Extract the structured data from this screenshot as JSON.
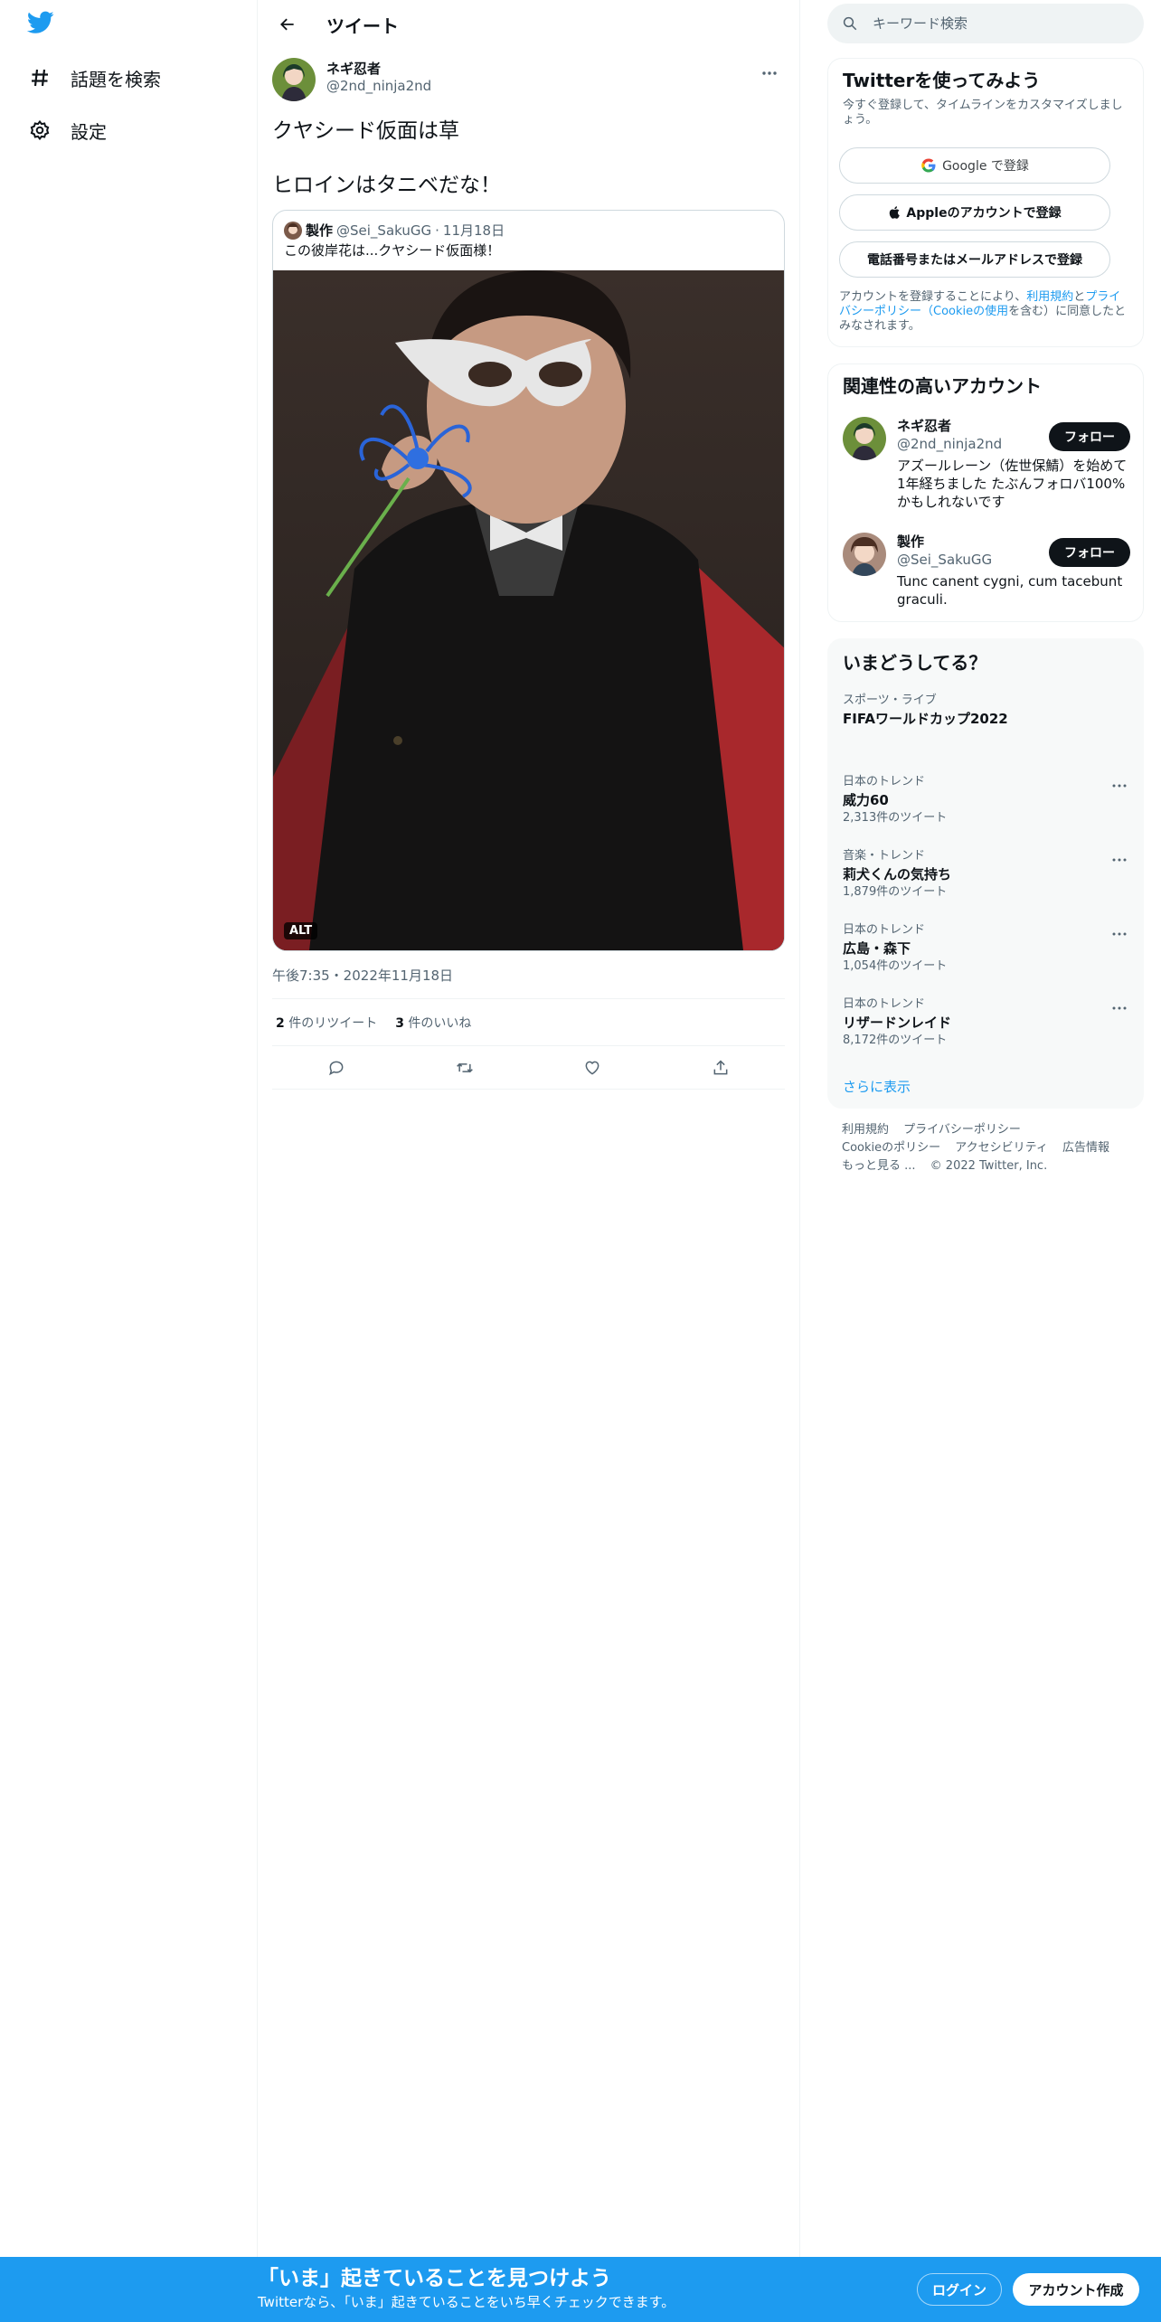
{
  "nav": {
    "items": [
      {
        "label": "話題を検索",
        "icon": "hashtag-icon"
      },
      {
        "label": "設定",
        "icon": "gear-icon"
      }
    ]
  },
  "header": {
    "title": "ツイート"
  },
  "tweet": {
    "author_name": "ネギ忍者",
    "author_handle": "@2nd_ninja2nd",
    "text_lines": [
      "クヤシード仮面は草",
      "ヒロインはタニベだな！"
    ],
    "quote": {
      "name": "製作",
      "handle": "@Sei_SakuGG",
      "dot": "·",
      "date": "11月18日",
      "text": "この彼岸花は...クヤシード仮面様！",
      "alt_badge": "ALT"
    },
    "timestamp": "午後7:35・2022年11月18日",
    "retweets_count": "2",
    "retweets_label": "件のリツイート",
    "likes_count": "3",
    "likes_label": "件のいいね"
  },
  "search": {
    "placeholder": "キーワード検索"
  },
  "signup": {
    "title": "Twitterを使ってみよう",
    "subtitle": "今すぐ登録して、タイムラインをカスタマイズしましょう。",
    "google_label": "Google で登録",
    "apple_label": "Appleのアカウントで登録",
    "phone_label": "電話番号またはメールアドレスで登録",
    "fine_1": "アカウントを登録することにより、",
    "fine_terms": "利用規約",
    "fine_2": "と",
    "fine_privacy": "プライバシーポリシー（Cookieの使用",
    "fine_3": "を含む）に同意したとみなされます。"
  },
  "related": {
    "title": "関連性の高いアカウント",
    "accounts": [
      {
        "name": "ネギ忍者",
        "handle": "@2nd_ninja2nd",
        "bio": "アズールレーン（佐世保鯖）を始めて1年経ちました たぶんフォロバ100%かもしれないです",
        "follow": "フォロー"
      },
      {
        "name": "製作",
        "handle": "@Sei_SakuGG",
        "bio": "Tunc canent cygni, cum tacebunt graculi.",
        "follow": "フォロー"
      }
    ]
  },
  "trends": {
    "title": "いまどうしてる？",
    "items": [
      {
        "category": "スポーツ・ライブ",
        "name": "FIFAワールドカップ2022",
        "count": ""
      },
      {
        "category": "日本のトレンド",
        "name": "威力60",
        "count": "2,313件のツイート"
      },
      {
        "category": "音楽・トレンド",
        "name": "莉犬くんの気持ち",
        "count": "1,879件のツイート"
      },
      {
        "category": "日本のトレンド",
        "name": "広島・森下",
        "count": "1,054件のツイート"
      },
      {
        "category": "日本のトレンド",
        "name": "リザードンレイド",
        "count": "8,172件のツイート"
      }
    ],
    "show_more": "さらに表示"
  },
  "footer": {
    "terms": "利用規約",
    "privacy": "プライバシーポリシー",
    "cookie": "Cookieのポリシー",
    "accessibility": "アクセシビリティ",
    "ads": "広告情報",
    "more": "もっと見る ...",
    "copyright": "© 2022 Twitter, Inc."
  },
  "banner": {
    "title": "「いま」起きていることを見つけよう",
    "subtitle": "Twitterなら、「いま」起きていることをいち早くチェックできます。",
    "login": "ログイン",
    "signup": "アカウント作成"
  },
  "colors": {
    "brand": "#1d9bf0",
    "text": "#0f1419",
    "muted": "#536471"
  }
}
